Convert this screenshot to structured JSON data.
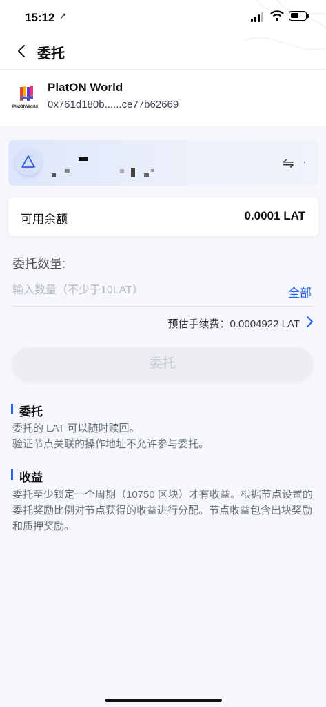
{
  "status": {
    "time": "15:12"
  },
  "nav": {
    "title": "委托"
  },
  "node": {
    "name": "PlatON World",
    "logo_text": "PlatONWorld",
    "address": "0x761d180b......ce77b62669"
  },
  "balance": {
    "label": "可用余额",
    "value": "0.0001 LAT"
  },
  "amount": {
    "title": "委托数量:",
    "placeholder": "输入数量（不少于10LAT）",
    "all_label": "全部"
  },
  "fee": {
    "text": "预估手续费：0.0004922 LAT"
  },
  "submit": {
    "label": "委托"
  },
  "sections": [
    {
      "title": "委托",
      "text": "委托的 LAT 可以随时赎回。\n验证节点关联的操作地址不允许参与委托。"
    },
    {
      "title": "收益",
      "text": "委托至少锁定一个周期（10750 区块）才有收益。根据节点设置的委托奖励比例对节点获得的收益进行分配。节点收益包含出块奖励和质押奖励。"
    }
  ],
  "colors": {
    "accent": "#1b60f3",
    "background": "#f6f7fb"
  }
}
